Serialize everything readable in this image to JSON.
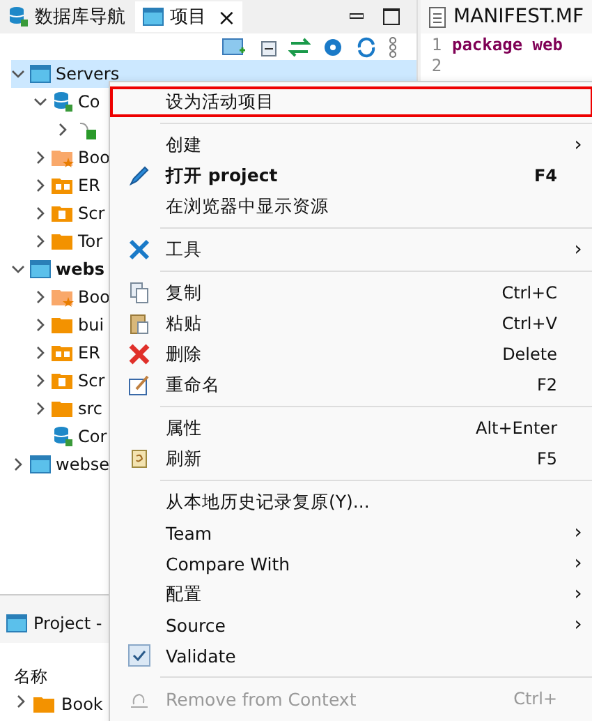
{
  "left_tabs": [
    {
      "label": "数据库导航",
      "selected": false,
      "closable": false
    },
    {
      "label": "项目",
      "selected": true,
      "closable": true
    }
  ],
  "close_glyph": "×",
  "tree": [
    {
      "label": "Servers",
      "kind": "project",
      "expanded": true,
      "selected": true,
      "bold": false,
      "children": [
        {
          "label": "Co",
          "kind": "database",
          "expanded": true,
          "selected": false,
          "bold": false,
          "children": [
            {
              "kind": "server",
              "expanded": false,
              "selected": false
            }
          ]
        },
        {
          "label": "Boo",
          "kind": "bookmark",
          "expanded": false,
          "selected": false,
          "bold": false
        },
        {
          "label": "ER",
          "kind": "er",
          "expanded": false,
          "selected": false,
          "bold": false
        },
        {
          "label": "Scr",
          "kind": "script",
          "expanded": false,
          "selected": false,
          "bold": false
        },
        {
          "label": "Tor",
          "kind": "folder",
          "expanded": false,
          "selected": false,
          "bold": false
        }
      ]
    },
    {
      "label": "webs",
      "kind": "project",
      "expanded": true,
      "selected": false,
      "bold": true,
      "children": [
        {
          "label": "Boo",
          "kind": "bookmark",
          "expanded": false,
          "selected": false,
          "bold": false
        },
        {
          "label": "bui",
          "kind": "folder",
          "expanded": false,
          "selected": false,
          "bold": false
        },
        {
          "label": "ER",
          "kind": "er",
          "expanded": false,
          "selected": false,
          "bold": false
        },
        {
          "label": "Scr",
          "kind": "script",
          "expanded": false,
          "selected": false,
          "bold": false
        },
        {
          "label": "src",
          "kind": "folder",
          "expanded": false,
          "selected": false,
          "bold": false
        },
        {
          "label": "Cor",
          "kind": "database",
          "leaf": true,
          "expanded": false,
          "selected": false,
          "bold": false
        }
      ]
    },
    {
      "label": "webse",
      "kind": "project",
      "expanded": false,
      "selected": false,
      "bold": false
    }
  ],
  "bottom_panel": {
    "tab": "Project -",
    "column": "名称",
    "row": "Book"
  },
  "editor": {
    "tab": "MANIFEST.MF",
    "lines": [
      {
        "number": "1",
        "code": "package web"
      },
      {
        "number": "2"
      }
    ]
  },
  "menu": [
    [
      {
        "label": "设为活动项目",
        "highlighted": true,
        "submenu": false
      }
    ],
    [
      {
        "label": "创建",
        "submenu": true,
        "highlighted": false
      },
      {
        "label": "打开 project",
        "shortcut": "F4",
        "bold": true,
        "submenu": false,
        "highlighted": false
      },
      {
        "label": "在浏览器中显示资源",
        "submenu": false,
        "highlighted": false
      }
    ],
    [
      {
        "label": "工具",
        "submenu": true,
        "highlighted": false
      }
    ],
    [
      {
        "label": "复制",
        "shortcut": "Ctrl+C",
        "submenu": false,
        "highlighted": false
      },
      {
        "label": "粘贴",
        "shortcut": "Ctrl+V",
        "submenu": false,
        "highlighted": false
      },
      {
        "label": "删除",
        "shortcut": "Delete",
        "submenu": false,
        "highlighted": false
      },
      {
        "label": "重命名",
        "shortcut": "F2",
        "submenu": false,
        "highlighted": false
      }
    ],
    [
      {
        "label": "属性",
        "shortcut": "Alt+Enter",
        "submenu": false,
        "highlighted": false
      },
      {
        "label": "刷新",
        "shortcut": "F5",
        "submenu": false,
        "highlighted": false
      }
    ],
    [
      {
        "label": "从本地历史记录复原(Y)...",
        "submenu": false,
        "highlighted": false
      },
      {
        "label": "Team",
        "submenu": true,
        "highlighted": false
      },
      {
        "label": "Compare With",
        "submenu": true,
        "highlighted": false
      },
      {
        "label": "配置",
        "submenu": true,
        "highlighted": false
      },
      {
        "label": "Source",
        "submenu": true,
        "highlighted": false
      },
      {
        "label": "Validate",
        "kind": "check",
        "checked": true,
        "submenu": false,
        "highlighted": false
      }
    ],
    [
      {
        "label": "Remove from Context",
        "shortcut": "Ctrl+",
        "disabled": true,
        "submenu": false,
        "highlighted": false
      }
    ]
  ],
  "submenu_glyph": "›"
}
